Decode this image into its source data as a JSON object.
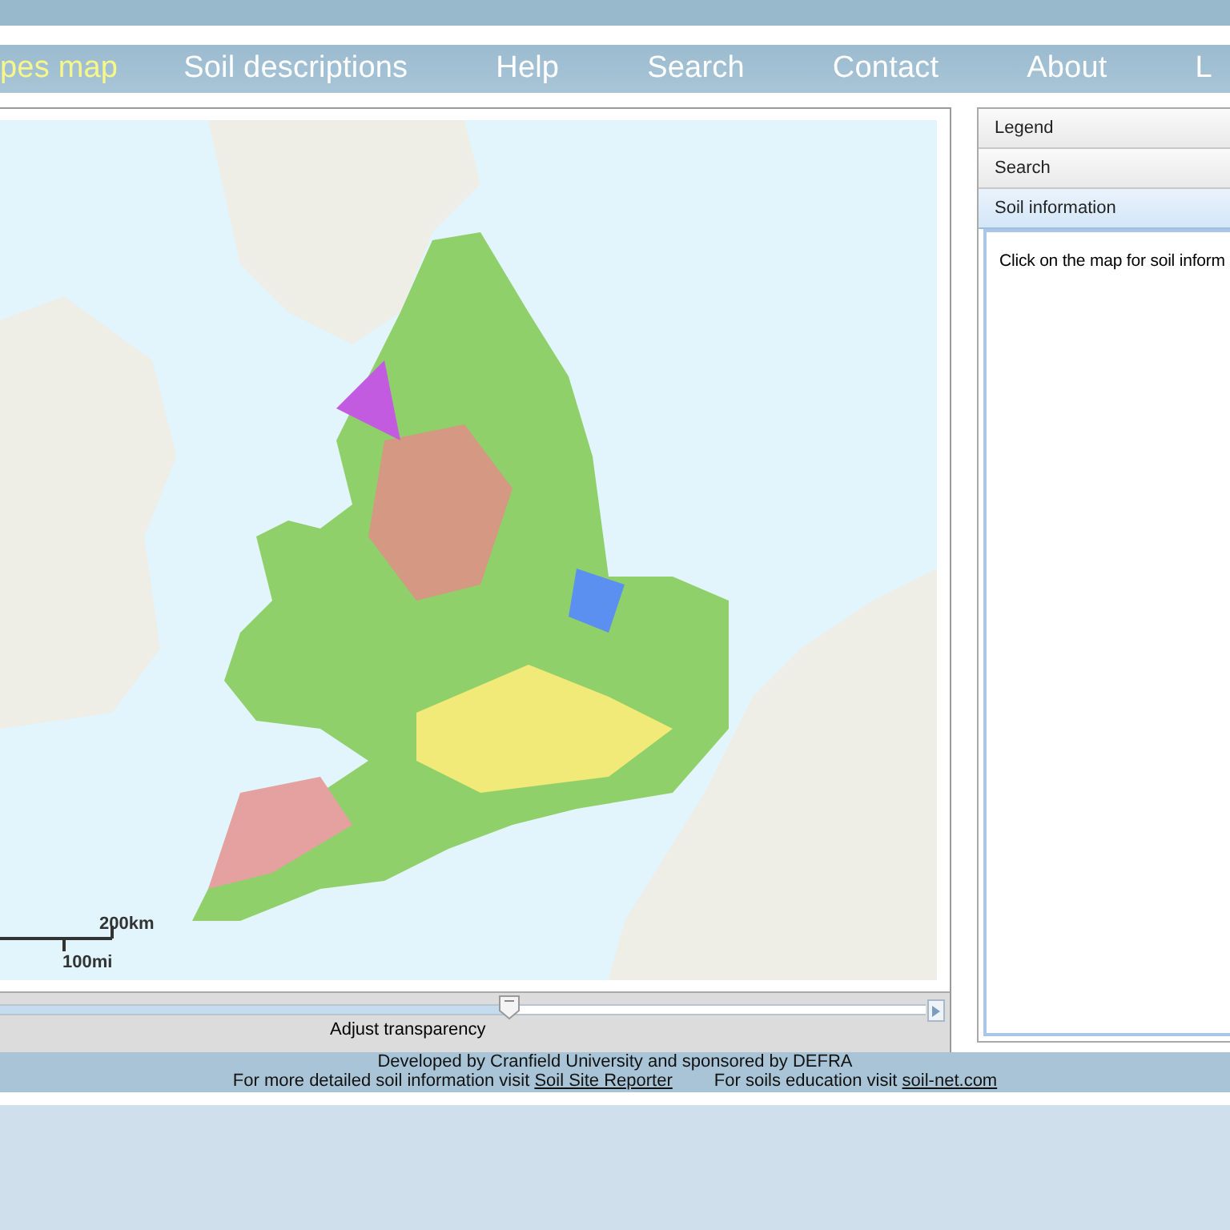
{
  "nav": {
    "items": [
      {
        "label": "pes map",
        "selected": true
      },
      {
        "label": "Soil descriptions",
        "selected": false
      },
      {
        "label": "Help",
        "selected": false
      },
      {
        "label": "Search",
        "selected": false
      },
      {
        "label": "Contact",
        "selected": false
      },
      {
        "label": "About",
        "selected": false
      },
      {
        "label": "L",
        "selected": false
      }
    ]
  },
  "map": {
    "scale": {
      "km": "200km",
      "mi": "100mi"
    },
    "transparency": {
      "level": 0.55,
      "label": "Adjust transparency"
    }
  },
  "panel": {
    "sections": [
      {
        "title": "Legend",
        "selected": false
      },
      {
        "title": "Search",
        "selected": false
      },
      {
        "title": "Soil information",
        "selected": true
      }
    ],
    "body": "Click on the map for soil inform"
  },
  "footer": {
    "credit": "Developed by Cranfield University and sponsored by DEFRA",
    "links": [
      {
        "text": "For more detailed soil information visit ",
        "link": "Soil Site Reporter"
      },
      {
        "text": "For soils education visit ",
        "link": "soil-net.com"
      }
    ]
  }
}
